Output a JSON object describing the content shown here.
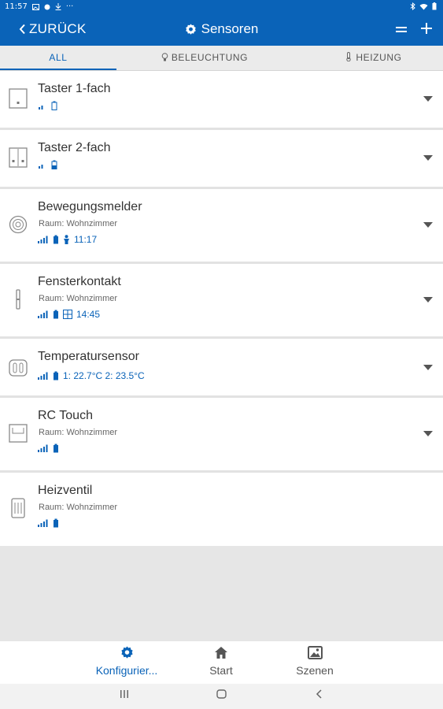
{
  "status_bar": {
    "time": "11:57",
    "more": "···"
  },
  "app_bar": {
    "back_label": "ZURÜCK",
    "title": "Sensoren",
    "menu_icon": "menu-icon",
    "add_icon": "plus-icon"
  },
  "tabs": [
    {
      "label": "ALL",
      "active": true
    },
    {
      "label": "BELEUCHTUNG",
      "active": false
    },
    {
      "label": "HEIZUNG",
      "active": false
    }
  ],
  "devices": [
    {
      "name": "Taster 1-fach",
      "room": "",
      "extra": "",
      "icon": "single-button-icon",
      "expandable": true
    },
    {
      "name": "Taster 2-fach",
      "room": "",
      "extra": "",
      "icon": "double-button-icon",
      "expandable": true
    },
    {
      "name": "Bewegungsmelder",
      "room": "Raum: Wohnzimmer",
      "extra": "11:17",
      "icon": "motion-sensor-icon",
      "expandable": true
    },
    {
      "name": "Fensterkontakt",
      "room": "Raum: Wohnzimmer",
      "extra": "14:45",
      "icon": "window-contact-icon",
      "expandable": true
    },
    {
      "name": "Temperatursensor",
      "room": "",
      "extra": "1: 22.7°C 2: 23.5°C",
      "icon": "temperature-sensor-icon",
      "expandable": true
    },
    {
      "name": "RC Touch",
      "room": "Raum: Wohnzimmer",
      "extra": "",
      "icon": "rc-touch-icon",
      "expandable": true
    },
    {
      "name": "Heizventil",
      "room": "Raum: Wohnzimmer",
      "extra": "",
      "icon": "heating-valve-icon",
      "expandable": false
    }
  ],
  "bottom_nav": [
    {
      "label": "Konfigurier...",
      "icon": "gear-icon",
      "active": true
    },
    {
      "label": "Start",
      "icon": "home-icon",
      "active": false
    },
    {
      "label": "Szenen",
      "icon": "scenes-icon",
      "active": false
    }
  ],
  "colors": {
    "primary": "#0a63b8",
    "tab_bg": "#ebebeb",
    "empty_bg": "#e6e6e6"
  }
}
